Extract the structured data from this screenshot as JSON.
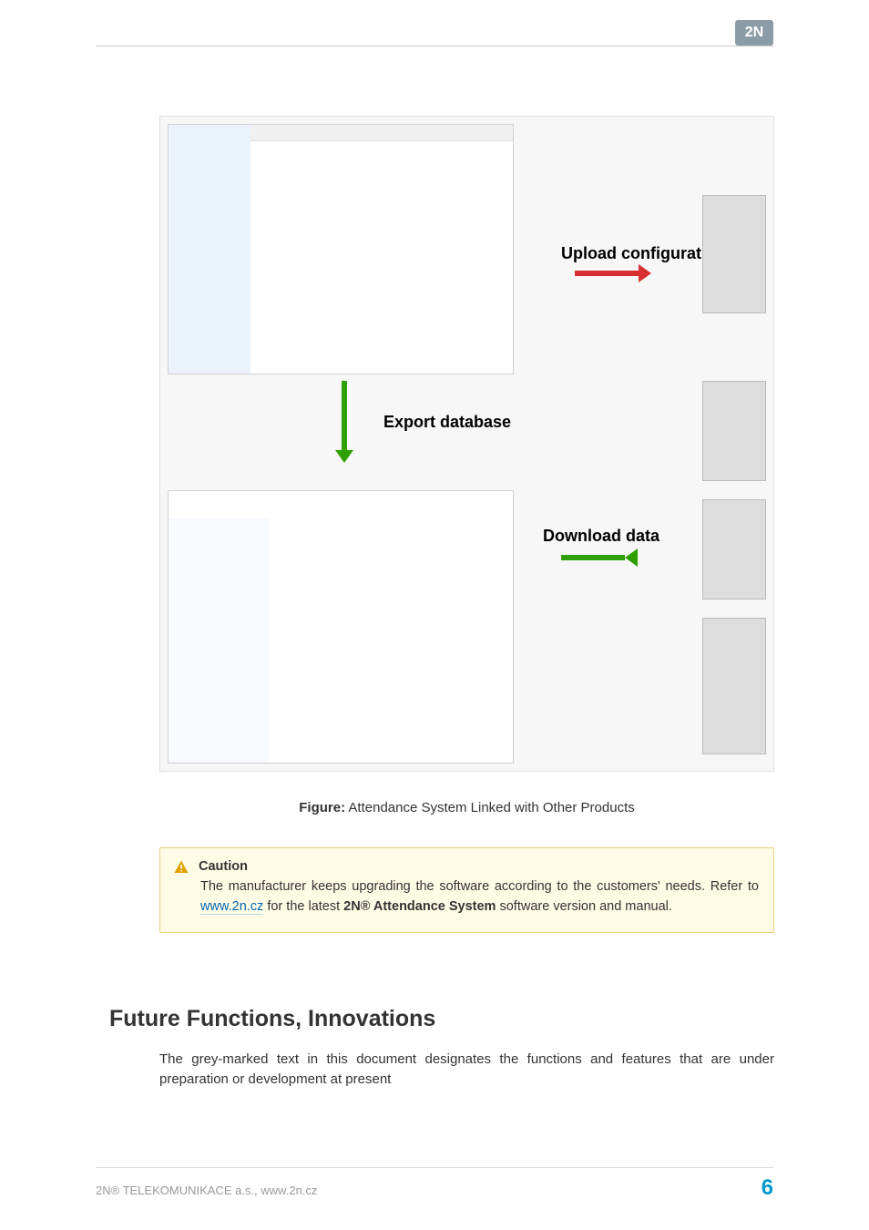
{
  "brand": "2N",
  "figure": {
    "labels": {
      "upload": "Upload configuration",
      "export_db": "Export database",
      "download": "Download data"
    },
    "caption_label": "Figure:",
    "caption_text": "Attendance System Linked with Other Products"
  },
  "caution": {
    "title": "Caution",
    "body_pre": "The manufacturer keeps upgrading the software according to the customers' needs. Refer to ",
    "link_text": "www.2n.cz",
    "body_mid": " for the latest ",
    "product_name": "2N® Attendance System",
    "body_post": " software version and manual."
  },
  "section": {
    "heading": "Future Functions, Innovations",
    "body": "The grey-marked text in this document designates the functions and features that are under preparation or development at present"
  },
  "footer": {
    "left": "2N® TELEKOMUNIKACE a.s., www.2n.cz",
    "page": "6"
  }
}
